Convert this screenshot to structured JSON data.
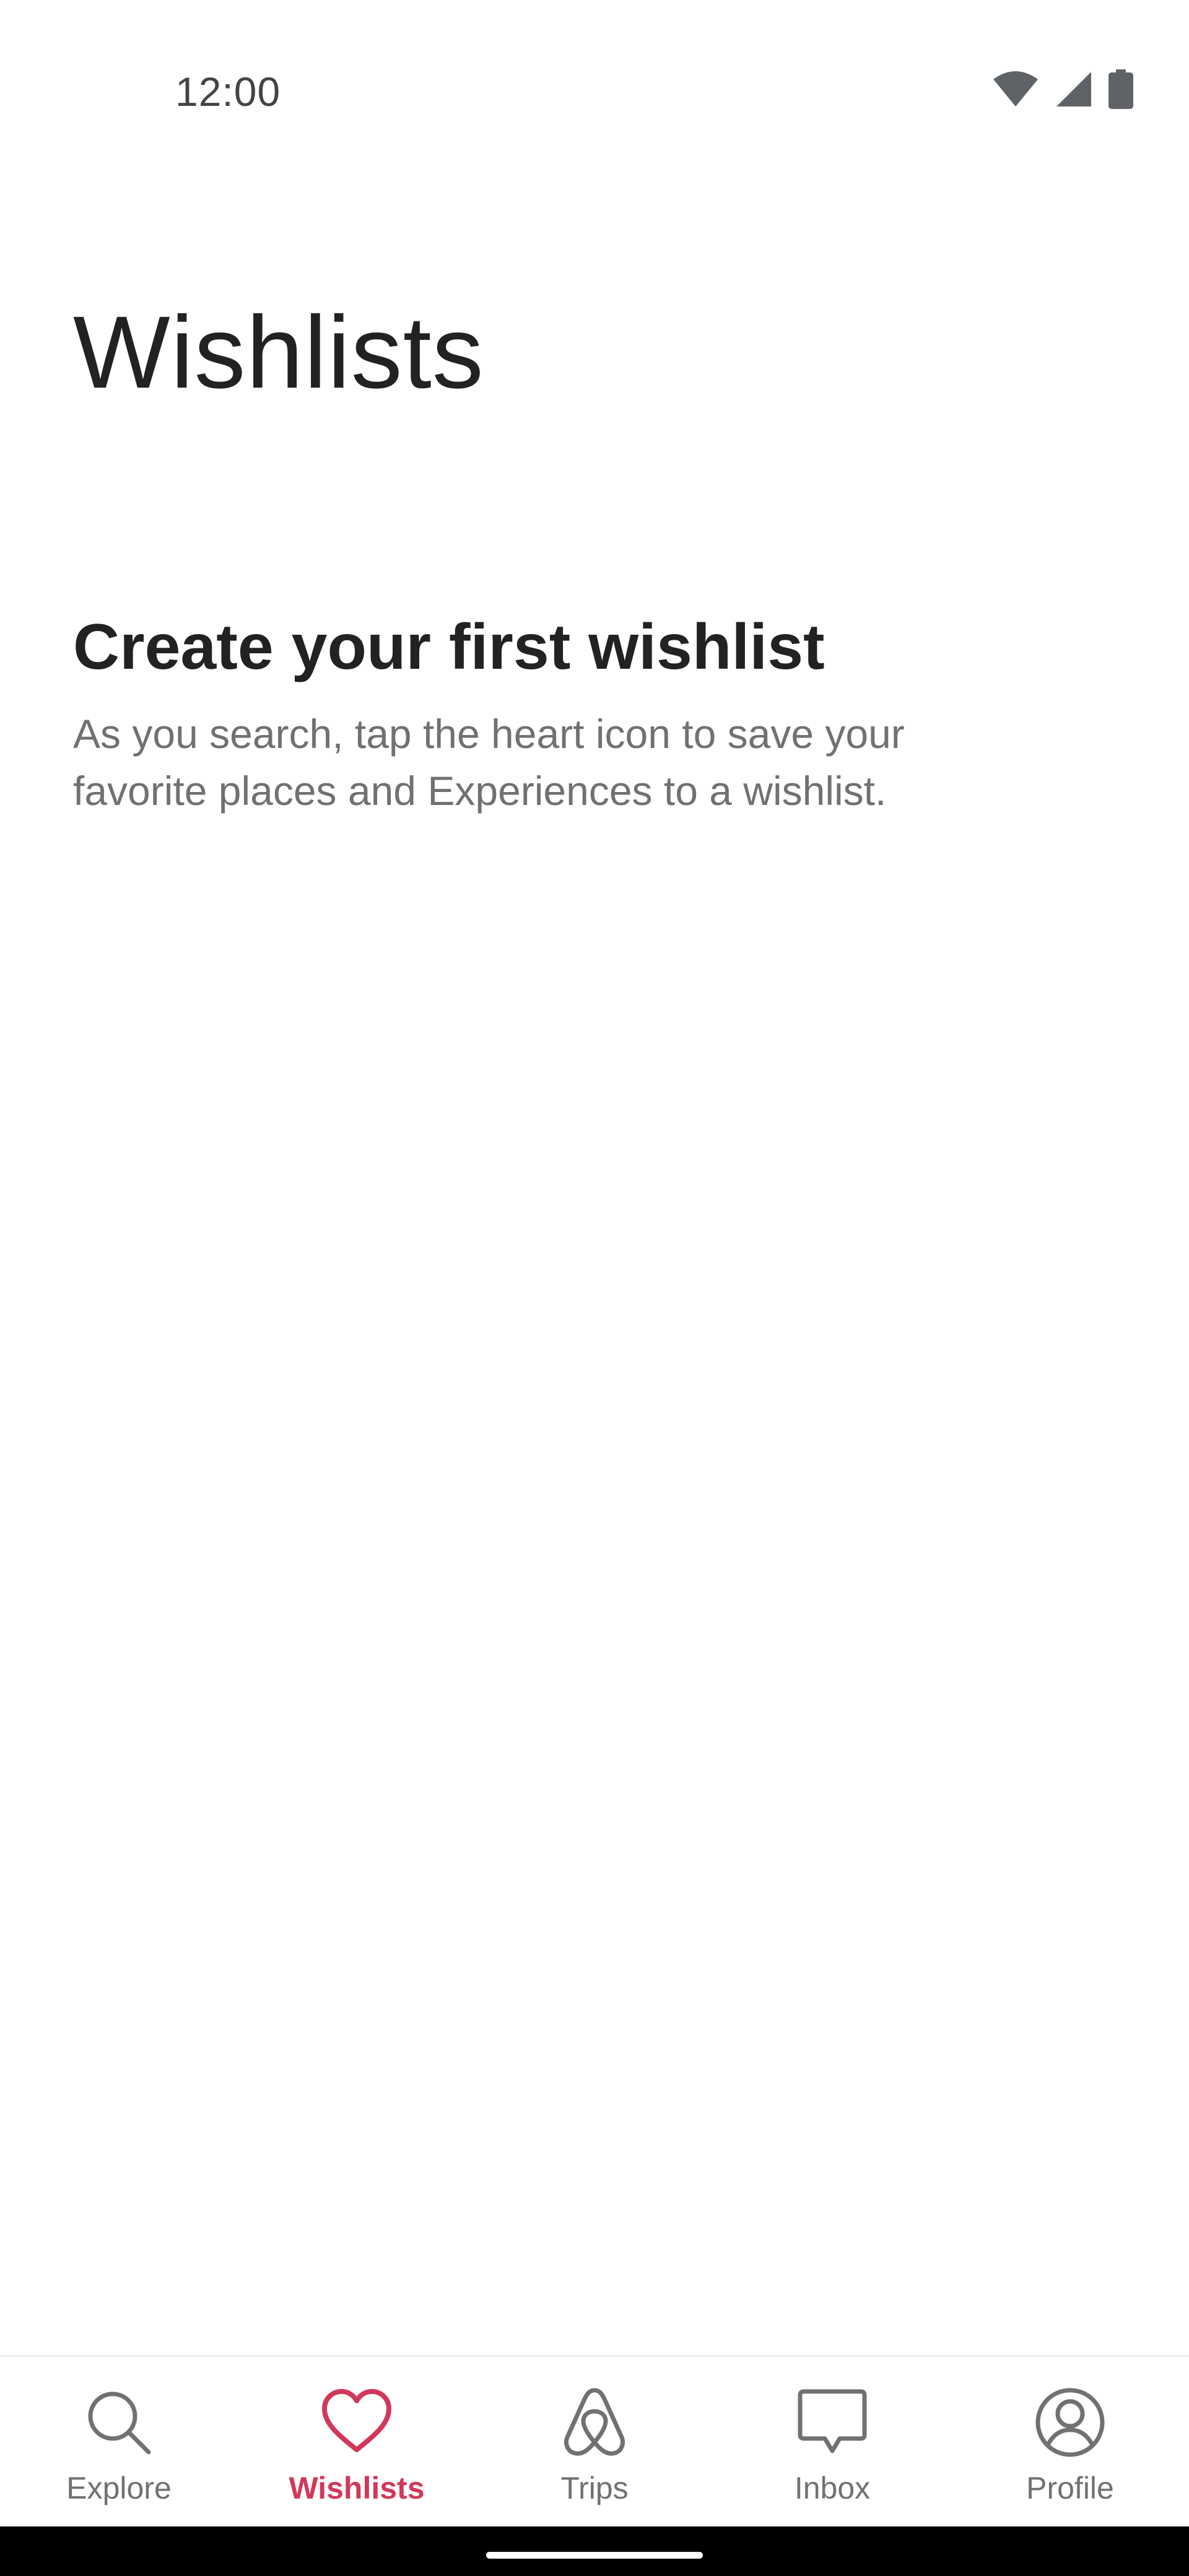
{
  "status_bar": {
    "time": "12:00",
    "icons": [
      "wifi-icon",
      "cellular-signal-icon",
      "battery-icon"
    ]
  },
  "page": {
    "title": "Wishlists"
  },
  "empty_state": {
    "heading": "Create your first wishlist",
    "body": "As you search, tap the heart icon to save your favorite places and Experiences to a wishlist."
  },
  "bottom_nav": {
    "active": "Wishlists",
    "active_color": "#d1385a",
    "inactive_color": "#717171",
    "items": [
      {
        "label": "Explore",
        "icon": "search-icon"
      },
      {
        "label": "Wishlists",
        "icon": "heart-icon"
      },
      {
        "label": "Trips",
        "icon": "airbnb-logo-icon"
      },
      {
        "label": "Inbox",
        "icon": "message-icon"
      },
      {
        "label": "Profile",
        "icon": "profile-icon"
      }
    ]
  }
}
